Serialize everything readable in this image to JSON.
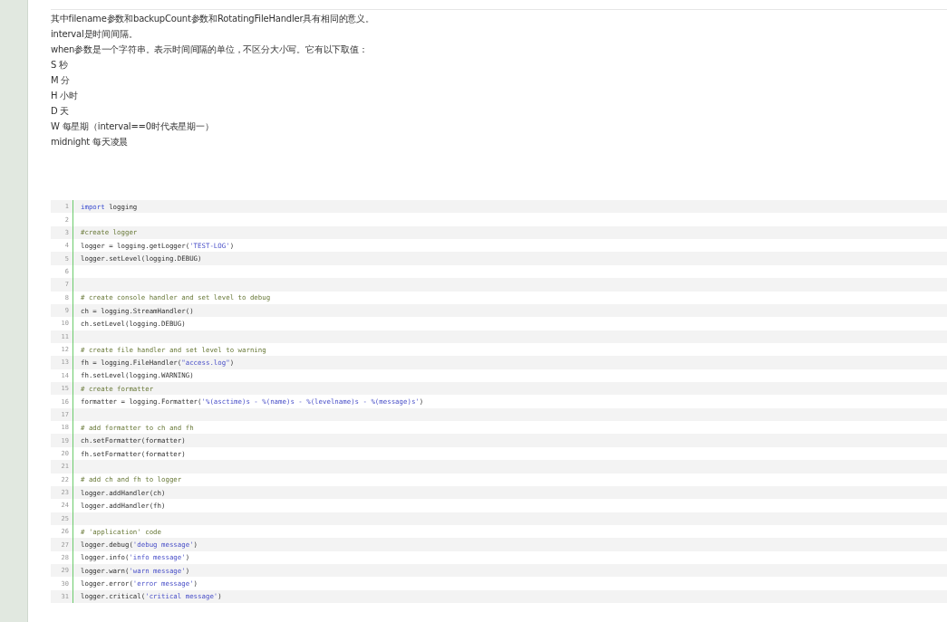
{
  "paragraphs": [
    "其中filename参数和backupCount参数和RotatingFileHandler具有相同的意义。",
    "interval是时间间隔。",
    "when参数是一个字符串。表示时间间隔的单位，不区分大小写。它有以下取值：",
    "S 秒",
    "M 分",
    "H 小时",
    "D 天",
    "W 每星期（interval==0时代表星期一）",
    "midnight 每天凌晨"
  ],
  "code": {
    "lines": [
      {
        "number": "1",
        "segments": [
          {
            "kind": "keyword",
            "text": "import"
          },
          {
            "kind": "plain",
            "text": " logging"
          }
        ]
      },
      {
        "number": "2"
      },
      {
        "number": "3",
        "segments": [
          {
            "kind": "comment",
            "text": "#create logger"
          }
        ]
      },
      {
        "number": "4",
        "segments": [
          {
            "kind": "plain",
            "text": "logger = logging.getLogger("
          },
          {
            "kind": "string",
            "text": "'TEST-LOG'"
          },
          {
            "kind": "plain",
            "text": ")"
          }
        ]
      },
      {
        "number": "5",
        "segments": [
          {
            "kind": "plain",
            "text": "logger.setLevel(logging.DEBUG)"
          }
        ]
      },
      {
        "number": "6"
      },
      {
        "number": "7"
      },
      {
        "number": "8",
        "segments": [
          {
            "kind": "comment",
            "text": "# create console handler and set level to debug"
          }
        ]
      },
      {
        "number": "9",
        "segments": [
          {
            "kind": "plain",
            "text": "ch = logging.StreamHandler()"
          }
        ]
      },
      {
        "number": "10",
        "segments": [
          {
            "kind": "plain",
            "text": "ch.setLevel(logging.DEBUG)"
          }
        ]
      },
      {
        "number": "11"
      },
      {
        "number": "12",
        "segments": [
          {
            "kind": "comment",
            "text": "# create file handler and set level to warning"
          }
        ]
      },
      {
        "number": "13",
        "segments": [
          {
            "kind": "plain",
            "text": "fh = logging.FileHandler("
          },
          {
            "kind": "string",
            "text": "\"access.log\""
          },
          {
            "kind": "plain",
            "text": ")"
          }
        ]
      },
      {
        "number": "14",
        "segments": [
          {
            "kind": "plain",
            "text": "fh.setLevel(logging.WARNING)"
          }
        ]
      },
      {
        "number": "15",
        "segments": [
          {
            "kind": "comment",
            "text": "# create formatter"
          }
        ]
      },
      {
        "number": "16",
        "segments": [
          {
            "kind": "plain",
            "text": "formatter = logging.Formatter("
          },
          {
            "kind": "string",
            "text": "'%(asctime)s - %(name)s - %(levelname)s - %(message)s'"
          },
          {
            "kind": "plain",
            "text": ")"
          }
        ]
      },
      {
        "number": "17"
      },
      {
        "number": "18",
        "segments": [
          {
            "kind": "comment",
            "text": "# add formatter to ch and fh"
          }
        ]
      },
      {
        "number": "19",
        "segments": [
          {
            "kind": "plain",
            "text": "ch.setFormatter(formatter)"
          }
        ]
      },
      {
        "number": "20",
        "segments": [
          {
            "kind": "plain",
            "text": "fh.setFormatter(formatter)"
          }
        ]
      },
      {
        "number": "21"
      },
      {
        "number": "22",
        "segments": [
          {
            "kind": "comment",
            "text": "# add ch and fh to logger"
          }
        ]
      },
      {
        "number": "23",
        "segments": [
          {
            "kind": "plain",
            "text": "logger.addHandler(ch)"
          }
        ]
      },
      {
        "number": "24",
        "segments": [
          {
            "kind": "plain",
            "text": "logger.addHandler(fh)"
          }
        ]
      },
      {
        "number": "25"
      },
      {
        "number": "26",
        "segments": [
          {
            "kind": "comment",
            "text": "# 'application' code"
          }
        ]
      },
      {
        "number": "27",
        "segments": [
          {
            "kind": "plain",
            "text": "logger.debug("
          },
          {
            "kind": "string",
            "text": "'debug message'"
          },
          {
            "kind": "plain",
            "text": ")"
          }
        ]
      },
      {
        "number": "28",
        "segments": [
          {
            "kind": "plain",
            "text": "logger.info("
          },
          {
            "kind": "string",
            "text": "'info message'"
          },
          {
            "kind": "plain",
            "text": ")"
          }
        ]
      },
      {
        "number": "29",
        "segments": [
          {
            "kind": "plain",
            "text": "logger.warn("
          },
          {
            "kind": "string",
            "text": "'warn message'"
          },
          {
            "kind": "plain",
            "text": ")"
          }
        ]
      },
      {
        "number": "30",
        "segments": [
          {
            "kind": "plain",
            "text": "logger.error("
          },
          {
            "kind": "string",
            "text": "'error message'"
          },
          {
            "kind": "plain",
            "text": ")"
          }
        ]
      },
      {
        "number": "31",
        "segments": [
          {
            "kind": "plain",
            "text": "logger.critical("
          },
          {
            "kind": "string",
            "text": "'critical message'"
          },
          {
            "kind": "plain",
            "text": ")"
          }
        ]
      }
    ]
  }
}
